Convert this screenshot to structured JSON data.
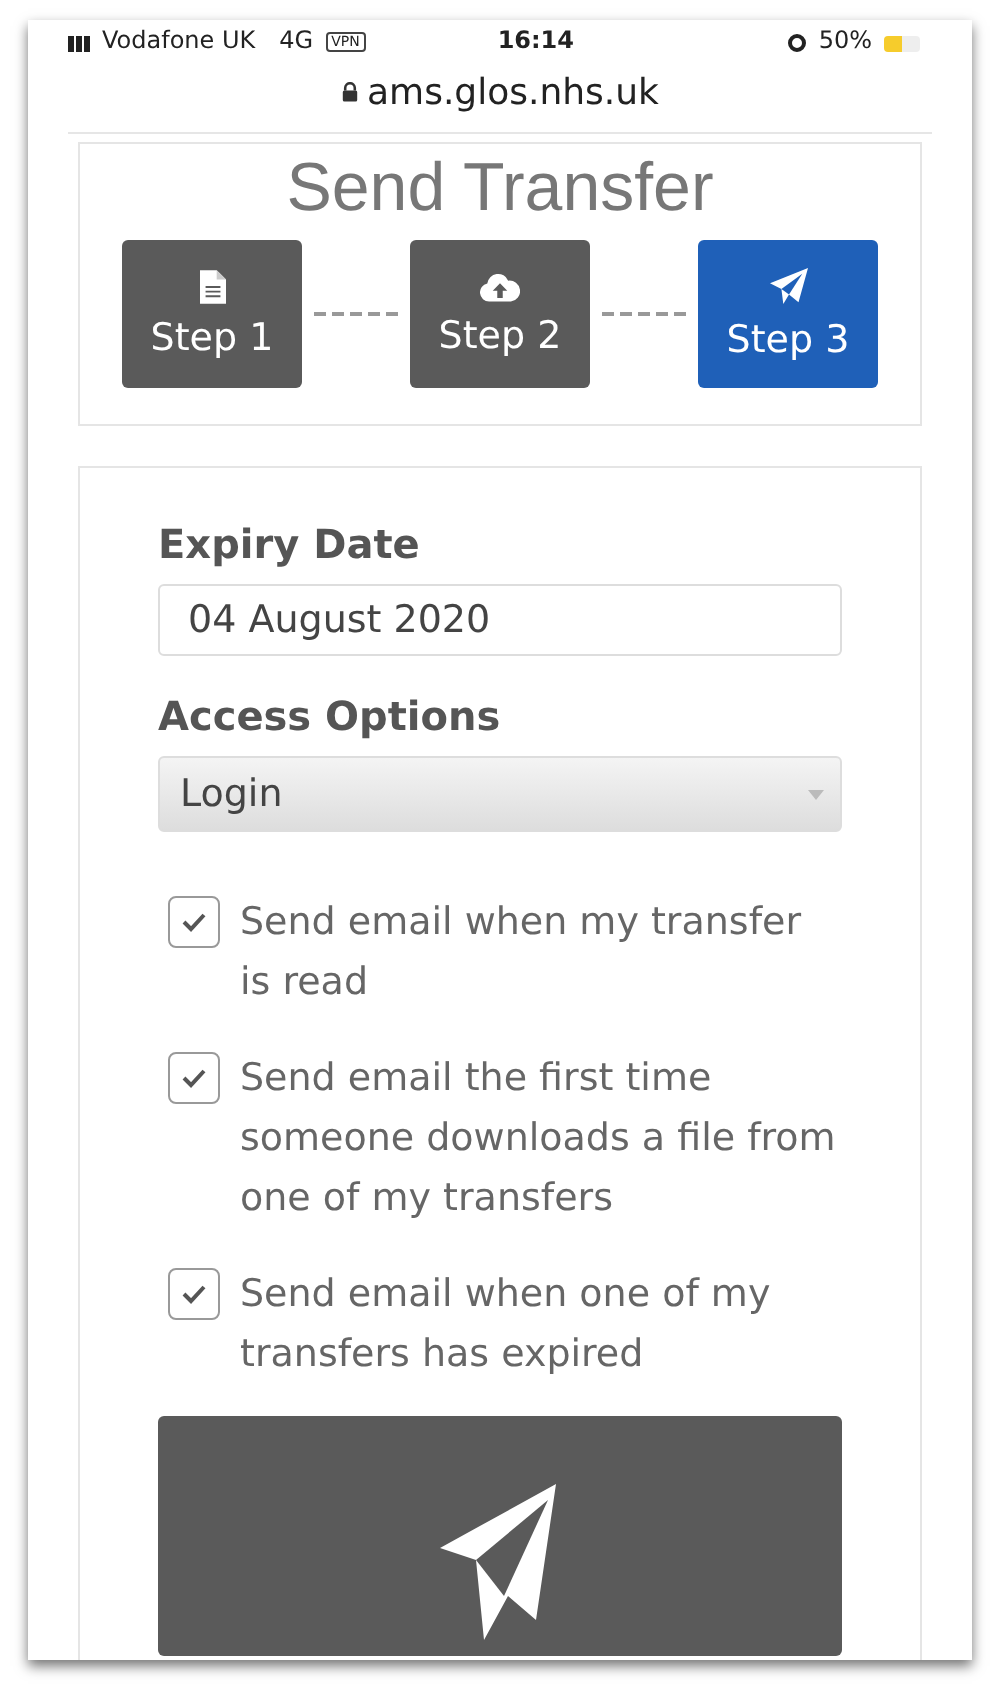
{
  "status_bar": {
    "carrier": "Vodafone UK",
    "network": "4G",
    "vpn": "VPN",
    "time": "16:14",
    "battery": "50%"
  },
  "address_bar": {
    "url": "ams.glos.nhs.uk"
  },
  "title": "Send Transfer",
  "steps": [
    {
      "label": "Step 1",
      "selected": false
    },
    {
      "label": "Step 2",
      "selected": false
    },
    {
      "label": "Step 3",
      "selected": true
    }
  ],
  "form": {
    "expiry": {
      "label": "Expiry Date",
      "value": "04 August 2020"
    },
    "access": {
      "label": "Access Options",
      "value": "Login"
    },
    "notifications": [
      {
        "label": "Send email when my transfer is read",
        "checked": true
      },
      {
        "label": "Send email the first time someone downloads a file from one of my transfers",
        "checked": true
      },
      {
        "label": "Send email when one of my transfers has expired",
        "checked": true
      }
    ]
  }
}
